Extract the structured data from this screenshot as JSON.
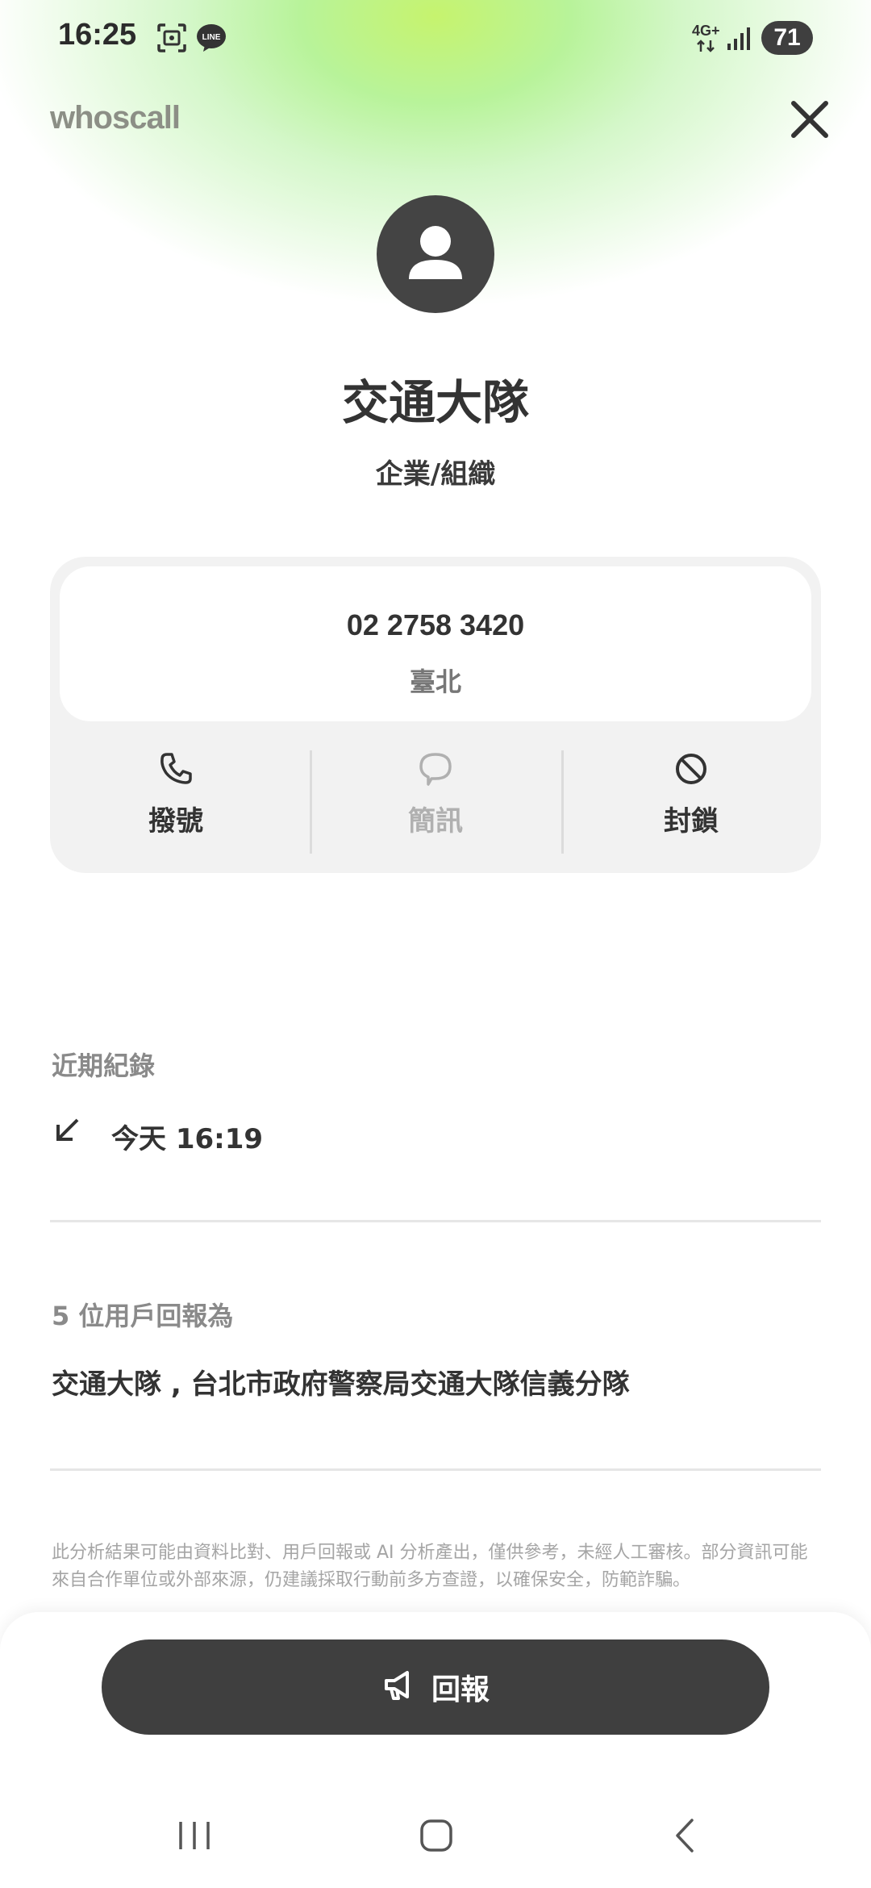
{
  "status_bar": {
    "time": "16:25",
    "network": "4G+",
    "battery": "71",
    "icons": [
      "screenshot-icon",
      "line-app-icon",
      "data-arrows-icon",
      "signal-icon"
    ]
  },
  "header": {
    "brand": "whoscall",
    "close_icon": "close-icon"
  },
  "contact": {
    "avatar_icon": "person-icon",
    "name": "交通大隊",
    "type": "企業/組織",
    "phone_number": "02 2758 3420",
    "location": "臺北"
  },
  "actions": [
    {
      "label": "撥號",
      "icon": "phone-icon",
      "enabled": true
    },
    {
      "label": "簡訊",
      "icon": "message-icon",
      "enabled": false
    },
    {
      "label": "封鎖",
      "icon": "block-icon",
      "enabled": true
    }
  ],
  "recent": {
    "title": "近期紀錄",
    "calls": [
      {
        "direction_icon": "incoming-call-arrow-icon",
        "time": "今天 16:19"
      }
    ]
  },
  "reports": {
    "title": "5 位用戶回報為",
    "text": "交通大隊 , 台北市政府警察局交通大隊信義分隊"
  },
  "disclaimer": "此分析結果可能由資料比對、用戶回報或 AI 分析產出，僅供參考，未經人工審核。部分資訊可能來自合作單位或外部來源，仍建議採取行動前多方查證，以確保安全，防範詐騙。",
  "bottom": {
    "report_button": "回報",
    "report_icon": "megaphone-icon"
  },
  "nav": [
    "recent-apps-icon",
    "home-icon",
    "back-icon"
  ],
  "colors": {
    "accent_glow": "#c6f36e",
    "dark": "#3f3f3f",
    "muted": "#8a8a8a"
  }
}
